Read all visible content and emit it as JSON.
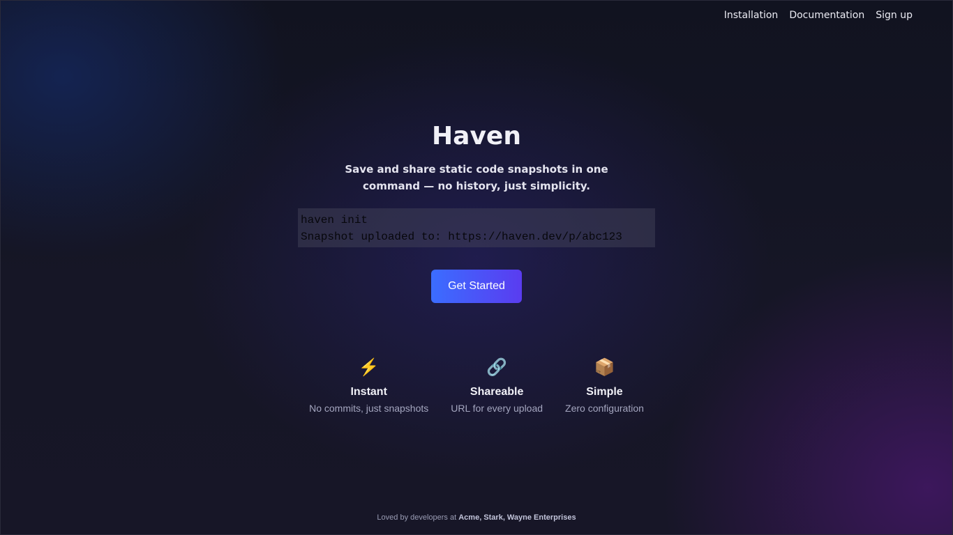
{
  "nav": {
    "links": [
      "Installation",
      "Documentation",
      "Sign up"
    ]
  },
  "hero": {
    "title": "Haven",
    "tagline": "Save and share static code snapshots in one command — no history, just simplicity.",
    "code_lines": [
      "haven init",
      "Snapshot uploaded to: https://haven.dev/p/abc123"
    ],
    "cta_label": "Get Started"
  },
  "features": [
    {
      "icon": "lightning-icon",
      "glyph": "⚡",
      "title": "Instant",
      "desc": "No commits, just snapshots"
    },
    {
      "icon": "link-icon",
      "glyph": "🔗",
      "title": "Shareable",
      "desc": "URL for every upload"
    },
    {
      "icon": "package-icon",
      "glyph": "📦",
      "title": "Simple",
      "desc": "Zero configuration"
    }
  ],
  "footer": {
    "prefix": "Loved by developers at",
    "companies": "Acme, Stark, Wayne Enterprises"
  },
  "colors": {
    "cta_start": "#3b6dff",
    "cta_end": "#5a3cf0"
  }
}
